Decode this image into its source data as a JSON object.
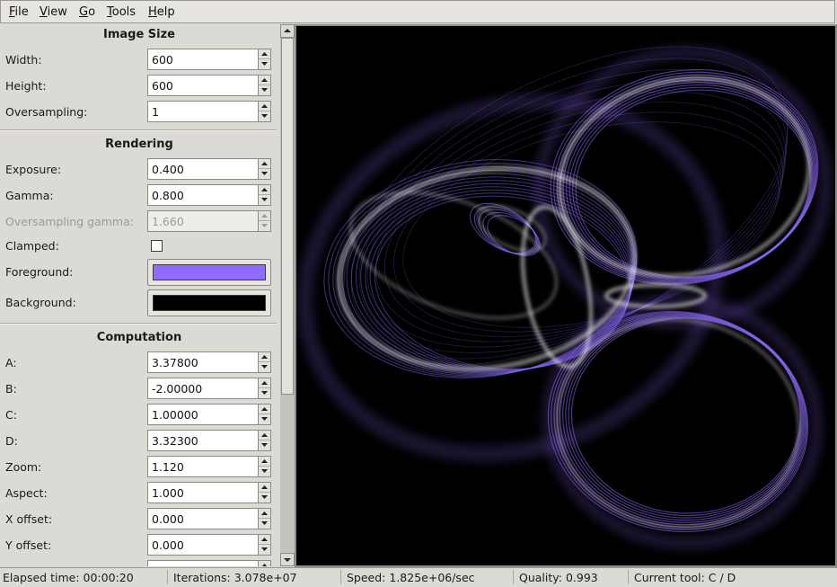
{
  "menu": [
    "File",
    "View",
    "Go",
    "Tools",
    "Help"
  ],
  "sections": {
    "image_size": "Image Size",
    "rendering": "Rendering",
    "computation": "Computation"
  },
  "fields": {
    "width": {
      "label": "Width:",
      "value": "600"
    },
    "height": {
      "label": "Height:",
      "value": "600"
    },
    "oversampling": {
      "label": "Oversampling:",
      "value": "1"
    },
    "exposure": {
      "label": "Exposure:",
      "value": "0.400"
    },
    "gamma": {
      "label": "Gamma:",
      "value": "0.800"
    },
    "oversampling_gamma": {
      "label": "Oversampling gamma:",
      "value": "1.660"
    },
    "clamped": {
      "label": "Clamped:",
      "checked": false
    },
    "foreground": {
      "label": "Foreground:",
      "color": "#8f6bff"
    },
    "background": {
      "label": "Background:",
      "color": "#000000"
    },
    "a": {
      "label": "A:",
      "value": "3.37800"
    },
    "b": {
      "label": "B:",
      "value": "-2.00000"
    },
    "c": {
      "label": "C:",
      "value": "1.00000"
    },
    "d": {
      "label": "D:",
      "value": "3.32300"
    },
    "zoom": {
      "label": "Zoom:",
      "value": "1.120"
    },
    "aspect": {
      "label": "Aspect:",
      "value": "1.000"
    },
    "x_offset": {
      "label": "X offset:",
      "value": "0.000"
    },
    "y_offset": {
      "label": "Y offset:",
      "value": "0.000"
    }
  },
  "status": {
    "elapsed": "Elapsed time: 00:00:20",
    "iterations": "Iterations: 3.078e+07",
    "speed": "Speed: 1.825e+06/sec",
    "quality": "Quality: 0.993",
    "tool": "Current tool: C / D"
  },
  "render": {
    "bg": "#000000",
    "fg": "#8f6bff",
    "glow": "#ffffff"
  }
}
